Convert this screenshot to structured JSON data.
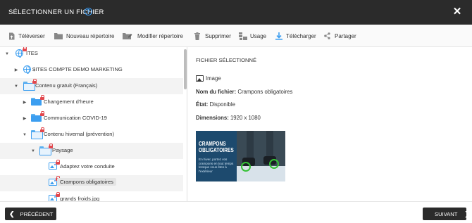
{
  "dialog": {
    "title": "SÉLECTIONNER UN FICHIER",
    "help_icon": "?",
    "close_icon": "✕"
  },
  "toolbar": {
    "items": [
      {
        "label": "Téléverser",
        "icon": "upload-file-icon"
      },
      {
        "label": "Nouveau répertoire",
        "icon": "new-folder-icon"
      },
      {
        "label": "Modifier répertoire",
        "icon": "edit-folder-icon"
      },
      {
        "label": "Supprimer",
        "icon": "trash-icon"
      },
      {
        "label": "Usage",
        "icon": "usage-icon"
      },
      {
        "label": "Télécharger",
        "icon": "download-icon"
      },
      {
        "label": "Partager",
        "icon": "share-icon"
      }
    ]
  },
  "tree": {
    "items": [
      {
        "label": "ITES",
        "icon": "globe-icon",
        "locked": true,
        "expanded": true
      },
      {
        "label": "$ITES COMPTE DEMO MARKETING",
        "icon": "globe-icon",
        "locked": false,
        "expanded": false
      },
      {
        "label": "Contenu gratuit (Français)",
        "icon": "folder-icon",
        "locked": true,
        "expanded": true
      },
      {
        "label": "Changement d'heure",
        "icon": "folder-icon",
        "locked": true,
        "expanded": false
      },
      {
        "label": "Communication COVID-19",
        "icon": "folder-icon",
        "locked": true,
        "expanded": false
      },
      {
        "label": "Contenu hivernal (prévention)",
        "icon": "folder-icon",
        "locked": true,
        "expanded": true
      },
      {
        "label": "Paysage",
        "icon": "folder-icon",
        "locked": true,
        "expanded": true
      },
      {
        "label": "Adaptez votre conduite",
        "icon": "image-file-icon",
        "locked": true
      },
      {
        "label": "Crampons obligatoires",
        "icon": "image-file-icon",
        "locked": true,
        "selected": true
      },
      {
        "label": "grands froids.jpg",
        "icon": "image-file-icon",
        "locked": true
      }
    ]
  },
  "details": {
    "heading": "FICHIER SÉLECTIONNÉ",
    "type": "Image",
    "filename_label": "Nom du fichier:",
    "filename": "Crampons obligatoires",
    "state_label": "État:",
    "state": "Disponible",
    "dimensions_label": "Dimensions:",
    "dimensions": "1920 x 1080",
    "preview": {
      "title": "CRAMPONS OBLIGATOIRES",
      "text": "En hiver, portez vos crampons en tout temps lorsque vous êtes à l'extérieur"
    }
  },
  "footer": {
    "prev_label": "PRÉCÉDENT",
    "next_label": "SUIVANT"
  },
  "colors": {
    "titlebar": "#2b2b2b",
    "accent_blue": "#3c9ef0",
    "lock_red": "#e2474d",
    "preview_bg": "#1d4a6e",
    "highlight_green": "#37c237"
  }
}
